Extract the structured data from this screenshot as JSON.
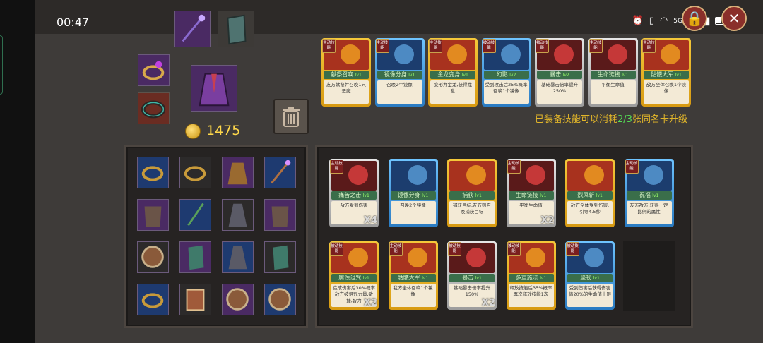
{
  "status_bar": {
    "time": "00:47",
    "network": "5G"
  },
  "gold": {
    "amount": "1475"
  },
  "upgrade_hint": {
    "prefix": "已装备技能可以消耗",
    "count": "2/3",
    "suffix": "张同名卡升级"
  },
  "equipped_skills": [
    {
      "type": "主动技能",
      "name": "献祭召唤",
      "level": "lv1",
      "desc": "友方献祭并召唤1只恶魔",
      "frame": "gold"
    },
    {
      "type": "主动技能",
      "name": "镜像分身",
      "level": "lv1",
      "desc": "召唤2个镜像",
      "frame": "blue"
    },
    {
      "type": "主动技能",
      "name": "金龙变身",
      "level": "lv1",
      "desc": "变形为金龙,获得龙息",
      "frame": "gold"
    },
    {
      "type": "被动技能",
      "name": "幻影",
      "level": "lv2",
      "desc": "受到攻击后25%概率召唤1个镜像",
      "frame": "blue"
    },
    {
      "type": "被动技能",
      "name": "暴击",
      "level": "lv2",
      "desc": "基础暴击倍率提升250%",
      "frame": "silver"
    },
    {
      "type": "主动技能",
      "name": "生命链接",
      "level": "lv1",
      "desc": "平衡生命值",
      "frame": "silver"
    },
    {
      "type": "主动技能",
      "name": "骷髅大军",
      "level": "lv1",
      "desc": "敌方全体召唤1个镜像",
      "frame": "gold"
    }
  ],
  "skill_inventory": [
    {
      "type": "主动技能",
      "name": "痛苦之击",
      "level": "lv1",
      "desc": "敌方受到伤害",
      "frame": "silver",
      "count": "X4"
    },
    {
      "type": "",
      "name": "镜像分身",
      "level": "lv1",
      "desc": "召唤2个镜像",
      "frame": "blue",
      "count": ""
    },
    {
      "type": "",
      "name": "捕获",
      "level": "lv1",
      "desc": "捕获目标,友方则召唤捕获目标",
      "frame": "gold",
      "count": ""
    },
    {
      "type": "主动技能",
      "name": "生命链接",
      "level": "lv1",
      "desc": "平衡生命值",
      "frame": "silver",
      "count": "X2"
    },
    {
      "type": "",
      "name": "烈风斩",
      "level": "lv1",
      "desc": "敌方全体受到伤害,引导4.5秒",
      "frame": "gold",
      "count": ""
    },
    {
      "type": "主动技能",
      "name": "祝福",
      "level": "lv1",
      "desc": "友方敌方,获得一定比例的属性",
      "frame": "blue",
      "count": ""
    },
    {
      "type": "被动技能",
      "name": "腐蚀诅咒",
      "level": "lv1",
      "desc": "造成伤害后30%概率敌方被诅咒力量,敏捷,智力",
      "frame": "gold",
      "count": "X2"
    },
    {
      "type": "主动技能",
      "name": "骷髅大军",
      "level": "lv1",
      "desc": "我方全体召唤1个镜像",
      "frame": "gold",
      "count": ""
    },
    {
      "type": "被动技能",
      "name": "暴击",
      "level": "lv1",
      "desc": "基础暴击倍率提升150%",
      "frame": "silver",
      "count": "X2"
    },
    {
      "type": "被动技能",
      "name": "多重施法",
      "level": "lv1",
      "desc": "释放技能后35%概率再次释放技能1次",
      "frame": "gold",
      "count": ""
    },
    {
      "type": "被动技能",
      "name": "坚韧",
      "level": "lv1",
      "desc": "受到伤害后获得伤害值20%的生命值上限",
      "frame": "blue",
      "count": ""
    }
  ],
  "equipped_items": [
    {
      "slot": "weapon",
      "icon": "staff-icon"
    },
    {
      "slot": "offhand",
      "icon": "bracer-icon"
    },
    {
      "slot": "ring-1",
      "icon": "ring-icon"
    },
    {
      "slot": "armor",
      "icon": "robe-icon"
    },
    {
      "slot": "ring-2",
      "icon": "ring-icon"
    }
  ],
  "item_inventory": [
    "ring-icon",
    "ring-icon",
    "robe-icon",
    "staff-icon",
    "armor-icon",
    "spear-icon",
    "cloak-icon",
    "armor-icon",
    "shield-icon",
    "bracer-icon",
    "cloak-icon",
    "bracer-icon",
    "ring-icon",
    "book-icon",
    "shield-icon",
    "shield-icon"
  ]
}
